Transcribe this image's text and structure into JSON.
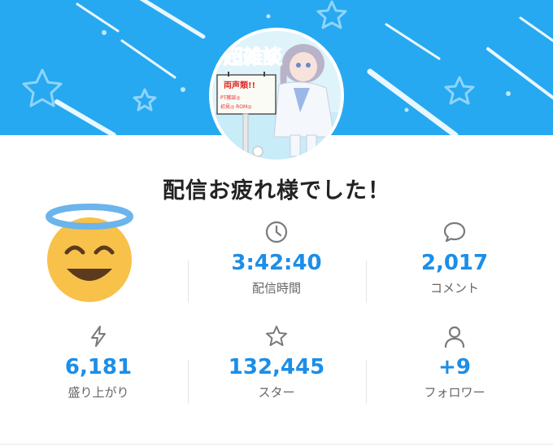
{
  "result": {
    "headline": "配信お疲れ様でした！",
    "accent_color": "#1b8ee8",
    "banner_color": "#26a9f0",
    "avatar_emoji": "smiling-face-with-halo"
  },
  "stats": [
    {
      "icon": "clock-icon",
      "value": "3:42:40",
      "label": "配信時間"
    },
    {
      "icon": "comment-icon",
      "value": "2,017",
      "label": "コメント"
    },
    {
      "icon": "lightning-icon",
      "value": "6,181",
      "label": "盛り上がり"
    },
    {
      "icon": "star-icon",
      "value": "132,445",
      "label": "スター"
    },
    {
      "icon": "person-icon",
      "value": "+9",
      "label": "フォロワー"
    }
  ],
  "thumbnail": {
    "title_art": "超雑談",
    "sign_text": "両声類!!",
    "sign_sub_1": "PT雑談◎",
    "sign_sub_2": "初見◎ ROM◎"
  }
}
